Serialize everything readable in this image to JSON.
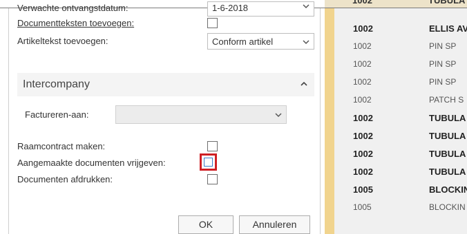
{
  "background_header": {
    "col1": "1002",
    "col2": "TUBULA"
  },
  "dialog": {
    "fields": {
      "expected_receipt_date": {
        "label": "Verwachte ontvangstdatum:",
        "value": "1-6-2018"
      },
      "document_texts": {
        "label": "Documentteksten toevoegen:",
        "checked": false
      },
      "article_text": {
        "label": "Artikeltekst toevoegen:",
        "value": "Conform artikel"
      }
    },
    "intercompany": {
      "title": "Intercompany",
      "invoice_to": {
        "label": "Factureren-aan:",
        "value": ""
      }
    },
    "options": {
      "framework_contract": {
        "label": "Raamcontract maken:",
        "checked": false
      },
      "release_created_docs": {
        "label": "Aangemaakte documenten vrijgeven:",
        "checked": false,
        "highlighted": true
      },
      "print_docs": {
        "label": "Documenten afdrukken:",
        "checked": false
      }
    },
    "buttons": {
      "ok": "OK",
      "cancel": "Annuleren"
    }
  },
  "list": {
    "rows": [
      {
        "c1": "1002",
        "c2": "ELLIS AV",
        "bold": true
      },
      {
        "c1": "1002",
        "c2": "PIN SP",
        "bold": false
      },
      {
        "c1": "1002",
        "c2": "PIN SP",
        "bold": false
      },
      {
        "c1": "1002",
        "c2": "PIN SP",
        "bold": false
      },
      {
        "c1": "1002",
        "c2": "PATCH S",
        "bold": false
      },
      {
        "c1": "1002",
        "c2": "TUBULA",
        "bold": true
      },
      {
        "c1": "1002",
        "c2": "TUBULA",
        "bold": true
      },
      {
        "c1": "1002",
        "c2": "TUBULA",
        "bold": true
      },
      {
        "c1": "1002",
        "c2": "TUBULA",
        "bold": true
      },
      {
        "c1": "1005",
        "c2": "BLOCKIN",
        "bold": true
      },
      {
        "c1": "1005",
        "c2": "BLOCKIN",
        "bold": false
      }
    ]
  },
  "colors": {
    "highlight": "#cf1f24",
    "stripe": "#f1d48e",
    "list_bg": "#f0f0f0"
  },
  "icons": {
    "dropdown": "chevron-down-icon",
    "collapse": "chevron-up-icon"
  }
}
